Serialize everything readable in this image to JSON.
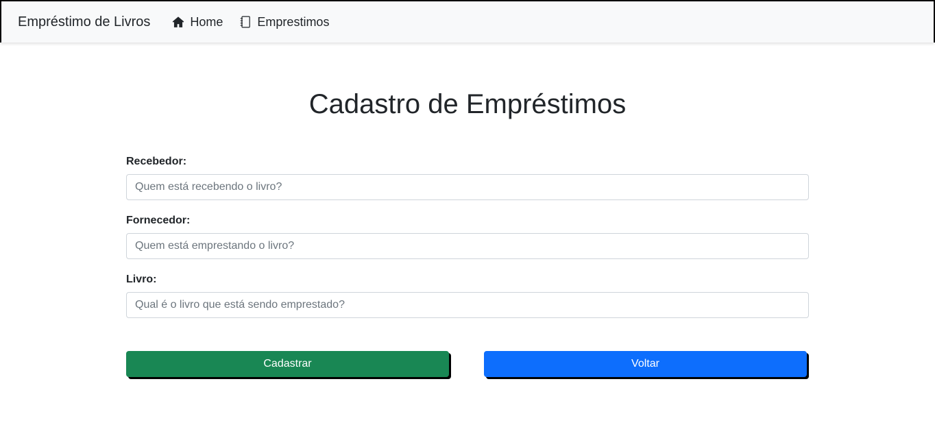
{
  "navbar": {
    "brand": "Empréstimo de Livros",
    "links": [
      {
        "label": "Home",
        "icon": "home-icon"
      },
      {
        "label": "Emprestimos",
        "icon": "notebook-icon"
      }
    ]
  },
  "page": {
    "title": "Cadastro de Empréstimos"
  },
  "form": {
    "recebedor": {
      "label": "Recebedor:",
      "placeholder": "Quem está recebendo o livro?",
      "value": ""
    },
    "fornecedor": {
      "label": "Fornecedor:",
      "placeholder": "Quem está emprestando o livro?",
      "value": ""
    },
    "livro": {
      "label": "Livro:",
      "placeholder": "Qual é o livro que está sendo emprestado?",
      "value": ""
    }
  },
  "buttons": {
    "cadastrar": "Cadastrar",
    "voltar": "Voltar"
  },
  "colors": {
    "success": "#198754",
    "primary": "#0d6efd",
    "navbar_bg": "#f8f9fa"
  }
}
